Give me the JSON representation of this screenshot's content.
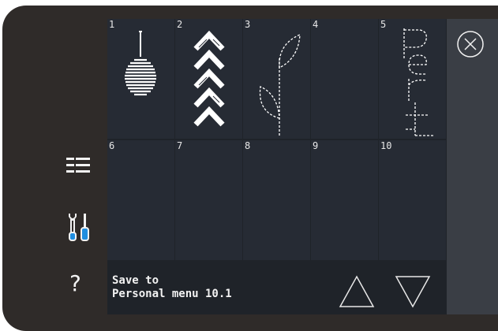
{
  "window": {
    "title": "Personal menu"
  },
  "cells": [
    {
      "number": "1",
      "design": "ornament-design"
    },
    {
      "number": "2",
      "design": "chevron-stack-design"
    },
    {
      "number": "3",
      "design": "leaf-stem-design"
    },
    {
      "number": "4",
      "design": "empty"
    },
    {
      "number": "5",
      "design": "perf-text-design"
    },
    {
      "number": "6",
      "design": "empty"
    },
    {
      "number": "7",
      "design": "empty"
    },
    {
      "number": "8",
      "design": "empty"
    },
    {
      "number": "9",
      "design": "empty"
    },
    {
      "number": "10",
      "design": "empty"
    }
  ],
  "footer": {
    "save_line1": "Save to",
    "save_line2": "Personal menu 10.1"
  },
  "sidebar": {
    "help_glyph": "?"
  },
  "icons": {
    "list": "list-icon",
    "tools": "tools-icon",
    "help": "help-icon",
    "close": "close-icon",
    "up": "arrow-up-icon",
    "down": "arrow-down-icon"
  },
  "colors": {
    "bezel": "#2f2b29",
    "cell": "#262b34",
    "panel": "#3a3e45",
    "accent_blue": "#1f8ee0"
  }
}
